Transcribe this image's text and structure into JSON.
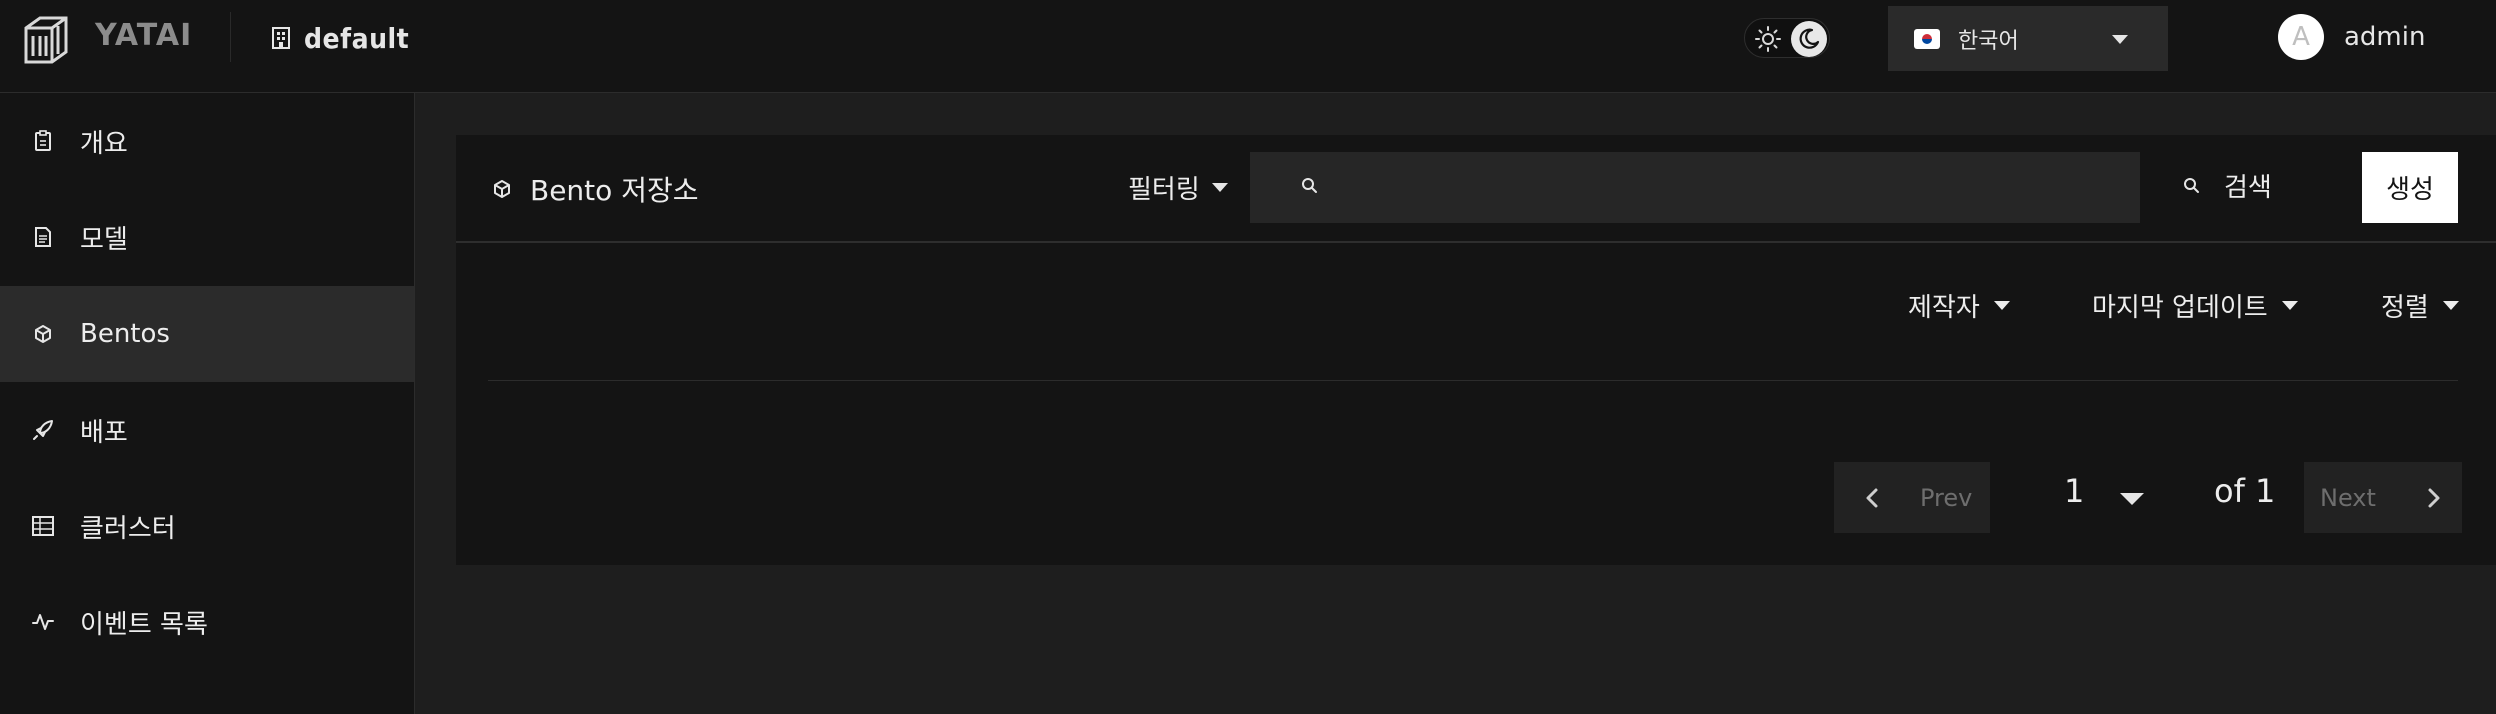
{
  "header": {
    "brand": "YATAI",
    "organization": "default",
    "organization_icon": "building-icon",
    "theme": {
      "mode": "dark",
      "light_icon": "sun-icon",
      "dark_icon": "moon-icon"
    },
    "language": {
      "flag": "kr-flag-icon",
      "label": "한국어"
    },
    "user": {
      "avatar_initial": "A",
      "name": "admin"
    }
  },
  "sidebar": {
    "items": [
      {
        "label": "개요",
        "icon": "clipboard-icon",
        "active": false
      },
      {
        "label": "모델",
        "icon": "file-icon",
        "active": false
      },
      {
        "label": "Bentos",
        "icon": "cube-icon",
        "active": true
      },
      {
        "label": "배포",
        "icon": "rocket-icon",
        "active": false
      },
      {
        "label": "클러스터",
        "icon": "cluster-icon",
        "active": false
      },
      {
        "label": "이벤트 목록",
        "icon": "activity-icon",
        "active": false
      }
    ]
  },
  "main": {
    "title": "Bento 저장소",
    "title_icon": "cube-icon",
    "filter_label": "필터링",
    "search": {
      "placeholder": "",
      "value": "",
      "button_label": "검색"
    },
    "create_label": "생성",
    "sort": {
      "creator": "제작자",
      "last_updated": "마지막 업데이트",
      "order": "정렬"
    },
    "pagination": {
      "prev_label": "Prev",
      "current_page": "1",
      "of_label": "of 1",
      "next_label": "Next"
    }
  }
}
